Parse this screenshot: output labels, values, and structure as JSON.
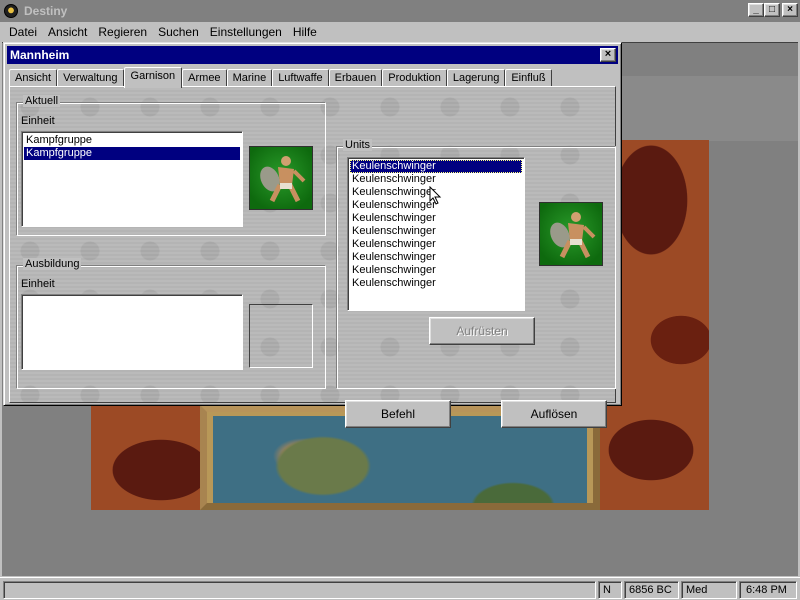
{
  "app": {
    "title": "Destiny",
    "min": "_",
    "max": "□",
    "close": "×"
  },
  "menu": [
    "Datei",
    "Ansicht",
    "Regieren",
    "Suchen",
    "Einstellungen",
    "Hilfe"
  ],
  "dialog": {
    "title": "Mannheim",
    "close": "×",
    "tabs": [
      "Ansicht",
      "Verwaltung",
      "Garnison",
      "Armee",
      "Marine",
      "Luftwaffe",
      "Erbauen",
      "Produktion",
      "Lagerung",
      "Einfluß"
    ],
    "active_tab": "Garnison",
    "aktuell": {
      "group_label": "Aktuell",
      "einheit_label": "Einheit",
      "items": [
        "Kampfgruppe",
        "Kampfgruppe"
      ],
      "selected_index": 1,
      "portrait": "club-warrior-portrait"
    },
    "ausbildung": {
      "group_label": "Ausbildung",
      "einheit_label": "Einheit",
      "items": []
    },
    "units": {
      "group_label": "Units",
      "items": [
        "Keulenschwinger",
        "Keulenschwinger",
        "Keulenschwinger",
        "Keulenschwinger",
        "Keulenschwinger",
        "Keulenschwinger",
        "Keulenschwinger",
        "Keulenschwinger",
        "Keulenschwinger",
        "Keulenschwinger"
      ],
      "selected_index": 0,
      "portrait": "club-warrior-portrait",
      "upgrade_button": "Aufrüsten",
      "upgrade_enabled": false
    },
    "buttons": {
      "command": "Befehl",
      "disband": "Auflösen"
    }
  },
  "statusbar": {
    "direction": "N",
    "year": "6856 BC",
    "difficulty": "Med",
    "time": "6:48 PM"
  },
  "colors": {
    "titlebar_active": "#000080",
    "titlebar_inactive": "#808080",
    "face": "#c0c0c0",
    "selection": "#000080"
  }
}
